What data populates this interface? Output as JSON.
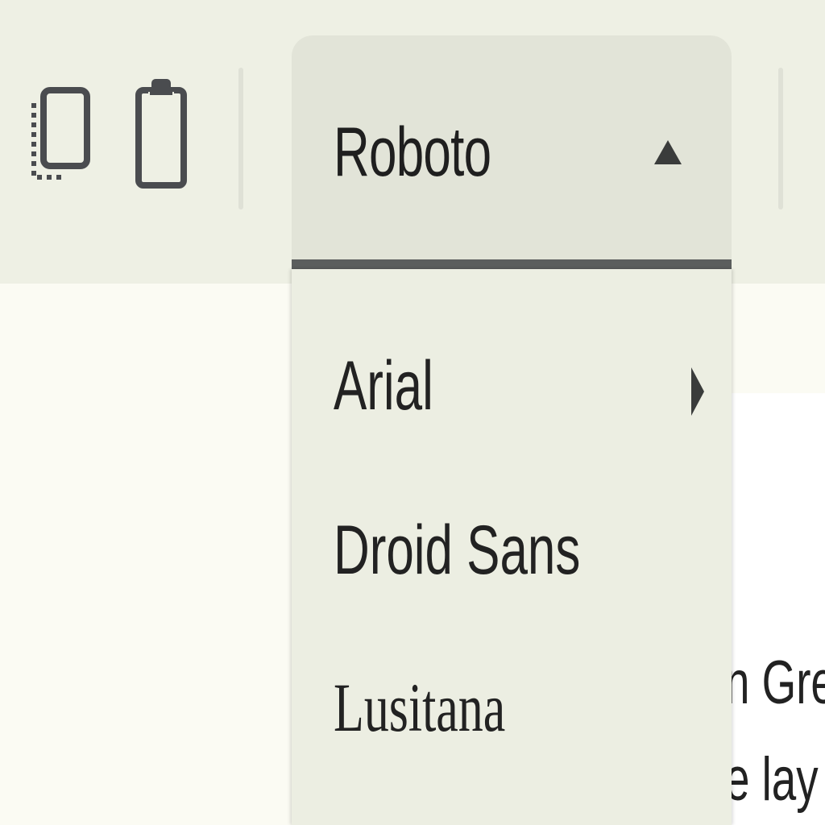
{
  "toolbar": {
    "font_select": {
      "value": "Roboto"
    }
  },
  "font_menu": {
    "items": [
      {
        "label": "Arial",
        "has_submenu": true
      },
      {
        "label": "Droid Sans",
        "has_submenu": false
      },
      {
        "label": "Lusitana",
        "has_submenu": false
      }
    ]
  },
  "document": {
    "lines": [
      "n Greg",
      "e lay c"
    ]
  },
  "colors": {
    "toolbar_bg": "#eef0e4",
    "select_bg": "#e2e4d8",
    "menu_bg": "#eceee2",
    "page_bg": "#fbfbf3",
    "underline": "#5b5e5d"
  }
}
